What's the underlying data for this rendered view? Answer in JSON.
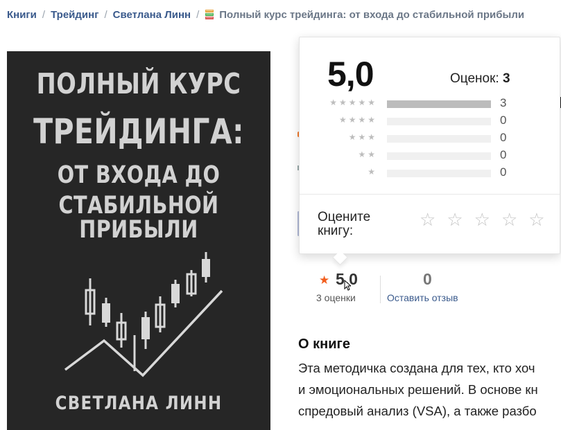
{
  "breadcrumb": {
    "items": [
      "Книги",
      "Трейдинг",
      "Светлана Линн"
    ],
    "current": "Полный курс трейдинга: от входа до стабильной прибыли"
  },
  "cover": {
    "title_lines": [
      "ПОЛНЫЙ КУРС",
      "ТРЕЙДИНГА:",
      "ОТ ВХОДА ДО",
      "СТАБИЛЬНОЙ ПРИБЫЛИ"
    ],
    "author": "СВЕТЛАНА ЛИНН"
  },
  "rating_popup": {
    "average": "5,0",
    "count_label": "Оценок:",
    "count": "3",
    "distribution": [
      {
        "stars": 5,
        "count": "3",
        "fraction": 1.0
      },
      {
        "stars": 4,
        "count": "0",
        "fraction": 0
      },
      {
        "stars": 3,
        "count": "0",
        "fraction": 0
      },
      {
        "stars": 2,
        "count": "0",
        "fraction": 0
      },
      {
        "stars": 1,
        "count": "0",
        "fraction": 0
      }
    ],
    "rate_prompt_line1": "Оцените",
    "rate_prompt_line2": "книгу:"
  },
  "summary": {
    "rating": "5.0",
    "ratings_count": "3 оценки",
    "reviews": "0",
    "leave_review": "Оставить отзыв"
  },
  "about": {
    "title": "О книге",
    "lines": [
      "Эта методичка создана для тех, кто хоч",
      "и эмоциональных решений. В основе кн",
      "спредовый анализ (VSA), а также разбо"
    ]
  },
  "colors": {
    "link": "#3a5a8c",
    "accent_star": "#f25e1e",
    "cover_bg": "#262626"
  }
}
